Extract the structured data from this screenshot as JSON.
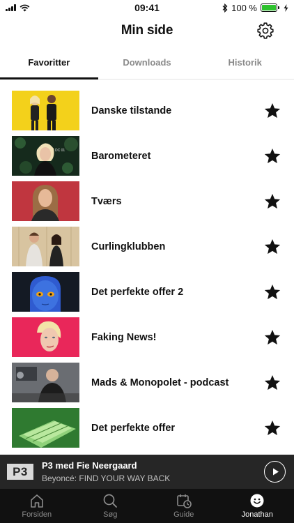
{
  "status_bar": {
    "time": "09:41",
    "battery_text": "100 %",
    "battery_level": 1.0,
    "battery_color": "#2ec22e",
    "icons": [
      "signal-icon",
      "wifi-icon",
      "bluetooth-icon",
      "battery-icon",
      "charging-icon"
    ]
  },
  "header": {
    "title": "Min side",
    "settings_icon": "gear-icon"
  },
  "tabs": [
    {
      "label": "Favoritter",
      "active": true
    },
    {
      "label": "Downloads",
      "active": false
    },
    {
      "label": "Historik",
      "active": false
    }
  ],
  "favorites": [
    {
      "title": "Danske tilstande",
      "starred": true
    },
    {
      "title": "Barometeret",
      "starred": true
    },
    {
      "title": "Tværs",
      "starred": true
    },
    {
      "title": "Curlingklubben",
      "starred": true
    },
    {
      "title": "Det perfekte offer 2",
      "starred": true
    },
    {
      "title": "Faking News!",
      "starred": true
    },
    {
      "title": "Mads & Monopolet - podcast",
      "starred": true
    },
    {
      "title": "Det perfekte offer",
      "starred": true
    }
  ],
  "player": {
    "logo": "P3",
    "title": "P3 med Fie Neergaard",
    "subtitle": "Beyoncé: FIND YOUR WAY BACK",
    "play_icon": "play-icon"
  },
  "bottom_nav": [
    {
      "label": "Forsiden",
      "icon": "home-icon",
      "active": false
    },
    {
      "label": "Søg",
      "icon": "search-icon",
      "active": false
    },
    {
      "label": "Guide",
      "icon": "calendar-clock-icon",
      "active": false
    },
    {
      "label": "Jonathan",
      "icon": "smiley-icon",
      "active": true
    }
  ],
  "colors": {
    "accent": "#111111",
    "inactive_tab": "#8a8a8a",
    "player_bg": "#262626",
    "nav_bg": "#111111"
  }
}
